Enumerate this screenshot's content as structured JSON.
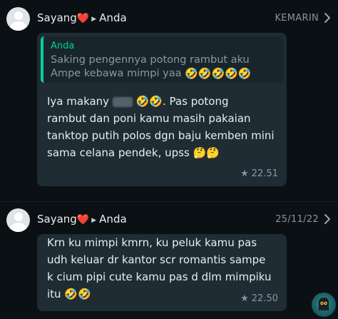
{
  "messages": [
    {
      "sender": "Sayang",
      "heart": "❤️",
      "arrow": "▶",
      "recipient": "Anda",
      "date": "KEMARIN",
      "quote": {
        "author": "Anda",
        "line1": "Saking pengennya potong rambut aku",
        "line2": "Ampe kebawa mimpi yaa"
      },
      "lines": [
        "Iya makany",
        ". Pas potong",
        "rambut dan poni kamu masih pakaian",
        "tanktop putih polos dgn baju kemben mini",
        "sama celana pendek, upss"
      ],
      "time": "22.51",
      "starred": true
    },
    {
      "sender": "Sayang",
      "heart": "❤️",
      "arrow": "▶",
      "recipient": "Anda",
      "date": "25/11/22",
      "lines": [
        "Krn ku mimpi kmrn, ku peluk kamu pas",
        "udh keluar dr kantor scr romantis sampe",
        "k cium pipi cute kamu pas d dlm mimpiku",
        "itu"
      ],
      "time": "22.50",
      "starred": true
    }
  ],
  "emoji": {
    "laugh": "🤣",
    "think": "🤔"
  },
  "icons": {
    "star": "star-icon",
    "chevron": "chevron-right-icon",
    "avatar": "default-avatar-icon",
    "fab": "meta-ai-button"
  },
  "colors": {
    "background": "#0b1014",
    "bubble": "#1f2c34",
    "quote_bar": "#06cf9c",
    "meta_text": "#8696a0",
    "heart": "#e8264c"
  }
}
